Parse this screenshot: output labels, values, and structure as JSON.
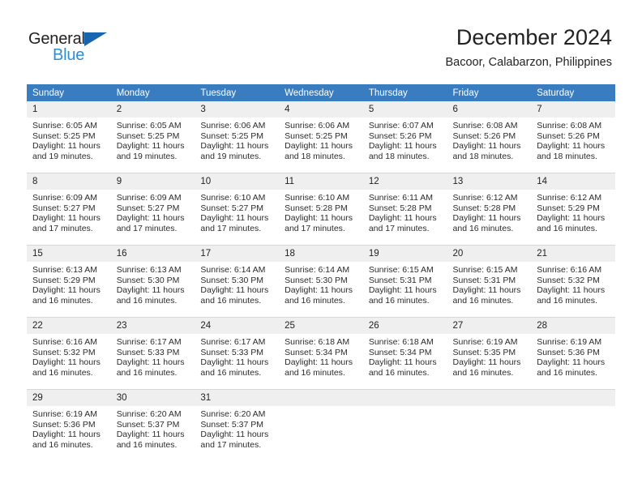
{
  "logo": {
    "text_primary": "General",
    "text_secondary": "Blue",
    "triangle_color": "#1565b0",
    "secondary_color": "#2b8fd6"
  },
  "header": {
    "title": "December 2024",
    "subtitle": "Bacoor, Calabarzon, Philippines"
  },
  "theme": {
    "header_bg": "#3a7cc0",
    "daynum_bg": "#efefef",
    "grid_line": "#d7d7d7"
  },
  "weekdays": [
    "Sunday",
    "Monday",
    "Tuesday",
    "Wednesday",
    "Thursday",
    "Friday",
    "Saturday"
  ],
  "labels": {
    "sunrise_prefix": "Sunrise:",
    "sunset_prefix": "Sunset:",
    "daylight_prefix": "Daylight:"
  },
  "weeks": [
    [
      {
        "day": "1",
        "sunrise": "Sunrise: 6:05 AM",
        "sunset": "Sunset: 5:25 PM",
        "daylight_line1": "Daylight: 11 hours",
        "daylight_line2": "and 19 minutes."
      },
      {
        "day": "2",
        "sunrise": "Sunrise: 6:05 AM",
        "sunset": "Sunset: 5:25 PM",
        "daylight_line1": "Daylight: 11 hours",
        "daylight_line2": "and 19 minutes."
      },
      {
        "day": "3",
        "sunrise": "Sunrise: 6:06 AM",
        "sunset": "Sunset: 5:25 PM",
        "daylight_line1": "Daylight: 11 hours",
        "daylight_line2": "and 19 minutes."
      },
      {
        "day": "4",
        "sunrise": "Sunrise: 6:06 AM",
        "sunset": "Sunset: 5:25 PM",
        "daylight_line1": "Daylight: 11 hours",
        "daylight_line2": "and 18 minutes."
      },
      {
        "day": "5",
        "sunrise": "Sunrise: 6:07 AM",
        "sunset": "Sunset: 5:26 PM",
        "daylight_line1": "Daylight: 11 hours",
        "daylight_line2": "and 18 minutes."
      },
      {
        "day": "6",
        "sunrise": "Sunrise: 6:08 AM",
        "sunset": "Sunset: 5:26 PM",
        "daylight_line1": "Daylight: 11 hours",
        "daylight_line2": "and 18 minutes."
      },
      {
        "day": "7",
        "sunrise": "Sunrise: 6:08 AM",
        "sunset": "Sunset: 5:26 PM",
        "daylight_line1": "Daylight: 11 hours",
        "daylight_line2": "and 18 minutes."
      }
    ],
    [
      {
        "day": "8",
        "sunrise": "Sunrise: 6:09 AM",
        "sunset": "Sunset: 5:27 PM",
        "daylight_line1": "Daylight: 11 hours",
        "daylight_line2": "and 17 minutes."
      },
      {
        "day": "9",
        "sunrise": "Sunrise: 6:09 AM",
        "sunset": "Sunset: 5:27 PM",
        "daylight_line1": "Daylight: 11 hours",
        "daylight_line2": "and 17 minutes."
      },
      {
        "day": "10",
        "sunrise": "Sunrise: 6:10 AM",
        "sunset": "Sunset: 5:27 PM",
        "daylight_line1": "Daylight: 11 hours",
        "daylight_line2": "and 17 minutes."
      },
      {
        "day": "11",
        "sunrise": "Sunrise: 6:10 AM",
        "sunset": "Sunset: 5:28 PM",
        "daylight_line1": "Daylight: 11 hours",
        "daylight_line2": "and 17 minutes."
      },
      {
        "day": "12",
        "sunrise": "Sunrise: 6:11 AM",
        "sunset": "Sunset: 5:28 PM",
        "daylight_line1": "Daylight: 11 hours",
        "daylight_line2": "and 17 minutes."
      },
      {
        "day": "13",
        "sunrise": "Sunrise: 6:12 AM",
        "sunset": "Sunset: 5:28 PM",
        "daylight_line1": "Daylight: 11 hours",
        "daylight_line2": "and 16 minutes."
      },
      {
        "day": "14",
        "sunrise": "Sunrise: 6:12 AM",
        "sunset": "Sunset: 5:29 PM",
        "daylight_line1": "Daylight: 11 hours",
        "daylight_line2": "and 16 minutes."
      }
    ],
    [
      {
        "day": "15",
        "sunrise": "Sunrise: 6:13 AM",
        "sunset": "Sunset: 5:29 PM",
        "daylight_line1": "Daylight: 11 hours",
        "daylight_line2": "and 16 minutes."
      },
      {
        "day": "16",
        "sunrise": "Sunrise: 6:13 AM",
        "sunset": "Sunset: 5:30 PM",
        "daylight_line1": "Daylight: 11 hours",
        "daylight_line2": "and 16 minutes."
      },
      {
        "day": "17",
        "sunrise": "Sunrise: 6:14 AM",
        "sunset": "Sunset: 5:30 PM",
        "daylight_line1": "Daylight: 11 hours",
        "daylight_line2": "and 16 minutes."
      },
      {
        "day": "18",
        "sunrise": "Sunrise: 6:14 AM",
        "sunset": "Sunset: 5:30 PM",
        "daylight_line1": "Daylight: 11 hours",
        "daylight_line2": "and 16 minutes."
      },
      {
        "day": "19",
        "sunrise": "Sunrise: 6:15 AM",
        "sunset": "Sunset: 5:31 PM",
        "daylight_line1": "Daylight: 11 hours",
        "daylight_line2": "and 16 minutes."
      },
      {
        "day": "20",
        "sunrise": "Sunrise: 6:15 AM",
        "sunset": "Sunset: 5:31 PM",
        "daylight_line1": "Daylight: 11 hours",
        "daylight_line2": "and 16 minutes."
      },
      {
        "day": "21",
        "sunrise": "Sunrise: 6:16 AM",
        "sunset": "Sunset: 5:32 PM",
        "daylight_line1": "Daylight: 11 hours",
        "daylight_line2": "and 16 minutes."
      }
    ],
    [
      {
        "day": "22",
        "sunrise": "Sunrise: 6:16 AM",
        "sunset": "Sunset: 5:32 PM",
        "daylight_line1": "Daylight: 11 hours",
        "daylight_line2": "and 16 minutes."
      },
      {
        "day": "23",
        "sunrise": "Sunrise: 6:17 AM",
        "sunset": "Sunset: 5:33 PM",
        "daylight_line1": "Daylight: 11 hours",
        "daylight_line2": "and 16 minutes."
      },
      {
        "day": "24",
        "sunrise": "Sunrise: 6:17 AM",
        "sunset": "Sunset: 5:33 PM",
        "daylight_line1": "Daylight: 11 hours",
        "daylight_line2": "and 16 minutes."
      },
      {
        "day": "25",
        "sunrise": "Sunrise: 6:18 AM",
        "sunset": "Sunset: 5:34 PM",
        "daylight_line1": "Daylight: 11 hours",
        "daylight_line2": "and 16 minutes."
      },
      {
        "day": "26",
        "sunrise": "Sunrise: 6:18 AM",
        "sunset": "Sunset: 5:34 PM",
        "daylight_line1": "Daylight: 11 hours",
        "daylight_line2": "and 16 minutes."
      },
      {
        "day": "27",
        "sunrise": "Sunrise: 6:19 AM",
        "sunset": "Sunset: 5:35 PM",
        "daylight_line1": "Daylight: 11 hours",
        "daylight_line2": "and 16 minutes."
      },
      {
        "day": "28",
        "sunrise": "Sunrise: 6:19 AM",
        "sunset": "Sunset: 5:36 PM",
        "daylight_line1": "Daylight: 11 hours",
        "daylight_line2": "and 16 minutes."
      }
    ],
    [
      {
        "day": "29",
        "sunrise": "Sunrise: 6:19 AM",
        "sunset": "Sunset: 5:36 PM",
        "daylight_line1": "Daylight: 11 hours",
        "daylight_line2": "and 16 minutes."
      },
      {
        "day": "30",
        "sunrise": "Sunrise: 6:20 AM",
        "sunset": "Sunset: 5:37 PM",
        "daylight_line1": "Daylight: 11 hours",
        "daylight_line2": "and 16 minutes."
      },
      {
        "day": "31",
        "sunrise": "Sunrise: 6:20 AM",
        "sunset": "Sunset: 5:37 PM",
        "daylight_line1": "Daylight: 11 hours",
        "daylight_line2": "and 17 minutes."
      },
      {
        "day": "",
        "sunrise": "",
        "sunset": "",
        "daylight_line1": "",
        "daylight_line2": ""
      },
      {
        "day": "",
        "sunrise": "",
        "sunset": "",
        "daylight_line1": "",
        "daylight_line2": ""
      },
      {
        "day": "",
        "sunrise": "",
        "sunset": "",
        "daylight_line1": "",
        "daylight_line2": ""
      },
      {
        "day": "",
        "sunrise": "",
        "sunset": "",
        "daylight_line1": "",
        "daylight_line2": ""
      }
    ]
  ]
}
